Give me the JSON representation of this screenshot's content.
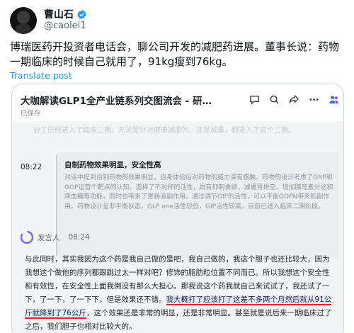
{
  "tweet": {
    "display_name": "曹山石",
    "handle": "@caolei1",
    "text": "博瑞医药开投资者电话会，聊公司开发的减肥药进展。董事长说：药物一期临床的时候自己就用了，91kg瘦到76kg。",
    "translate_label": "Translate post",
    "verified_color": "#1d9bf0"
  },
  "screenshot": {
    "app_title": "大咖解读GLP1全产业链系列交图流会 - 研…",
    "saved_status": "已保存",
    "faded_line": "分了已经进入了临床二期。无论是针对健康减肥的，还是减重，都进入了这个二期。",
    "section_time": "08:22",
    "section_title": "自制药物效果明显，安全性高",
    "section_body": "对话中提到自制药物的效果明显，自身体验后对药物的威力深有感触。药物的设计考虑了GRP和GOP运营个靶点的认知，选择了不对称的活性，具有抑制食欲、减缓胃排空、增加胰岛素分泌和降血糖等功能，同时也带来了胃肠道副作用。通过调节GIP的活性，可以平衡GOPN带来的副作用。药物设计呈非平衡状态，GLP one活性较低，GIP活性较高，目前已进入临床二期阶段。",
    "speaker_name": "发言人",
    "speaker_time": "08:24",
    "transcript_plain": "与此同时，其实我因为这个药是我自己做的是吧，我自己做的，我这个胆子也还比较大，因为我想这个做他的序列都跟跳过太一样对吧？修饰的脂肪粒位置不同而已。所以我想这个安全性和有效性，在安全性上面我倒没有那么大担心。那我说这个药我就自己来试试了，我还试了一下，了一下，了一下下，但是效果还不错。",
    "transcript_underlined_1": "我大概打了应该打了这差不多两个月然后就从91公斤",
    "transcript_underlined_2": "就降到了76公斤",
    "transcript_tail": "，这个效果还是非常的明显，还是非常明显。甚至就是说后来一期临床过了之后，我们胆子也相对比较大的。"
  }
}
